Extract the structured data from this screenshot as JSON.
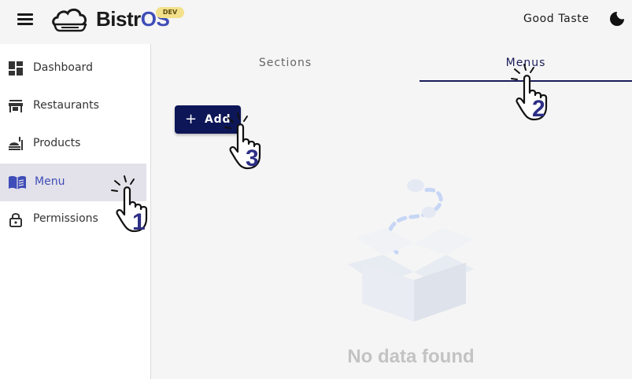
{
  "header": {
    "brand_part1": "Bistr",
    "brand_part2": "OS",
    "env_badge": "DEV",
    "company_name": "Good Taste",
    "menu_icon": "hamburger-icon",
    "logo_icon": "cloud-cooking-pot-logo",
    "theme_icon": "moon-icon"
  },
  "sidebar": {
    "items": [
      {
        "label": "Dashboard",
        "icon": "dashboard-icon"
      },
      {
        "label": "Restaurants",
        "icon": "storefront-icon"
      },
      {
        "label": "Products",
        "icon": "food-dish-icon"
      },
      {
        "label": "Menu",
        "icon": "menu-book-icon",
        "active": true
      },
      {
        "label": "Permissions",
        "icon": "lock-icon"
      }
    ]
  },
  "main": {
    "tabs": [
      {
        "label": "Sections",
        "active": false
      },
      {
        "label": "Menus",
        "active": true
      }
    ],
    "add_button": {
      "label": "Add",
      "icon": "plus-icon"
    },
    "empty_state": {
      "text": "No data found",
      "icon": "empty-box-icon"
    }
  },
  "tutorial_markers": [
    {
      "number": "1",
      "target": "Menu"
    },
    {
      "number": "2",
      "target": "Menus"
    },
    {
      "number": "3",
      "target": "Add"
    }
  ],
  "colors": {
    "accent": "#0d1657",
    "active_text": "#3f4db8",
    "active_bg": "#e3e2ea",
    "badge": "#f3e08a",
    "marker": "#2d2f86"
  }
}
